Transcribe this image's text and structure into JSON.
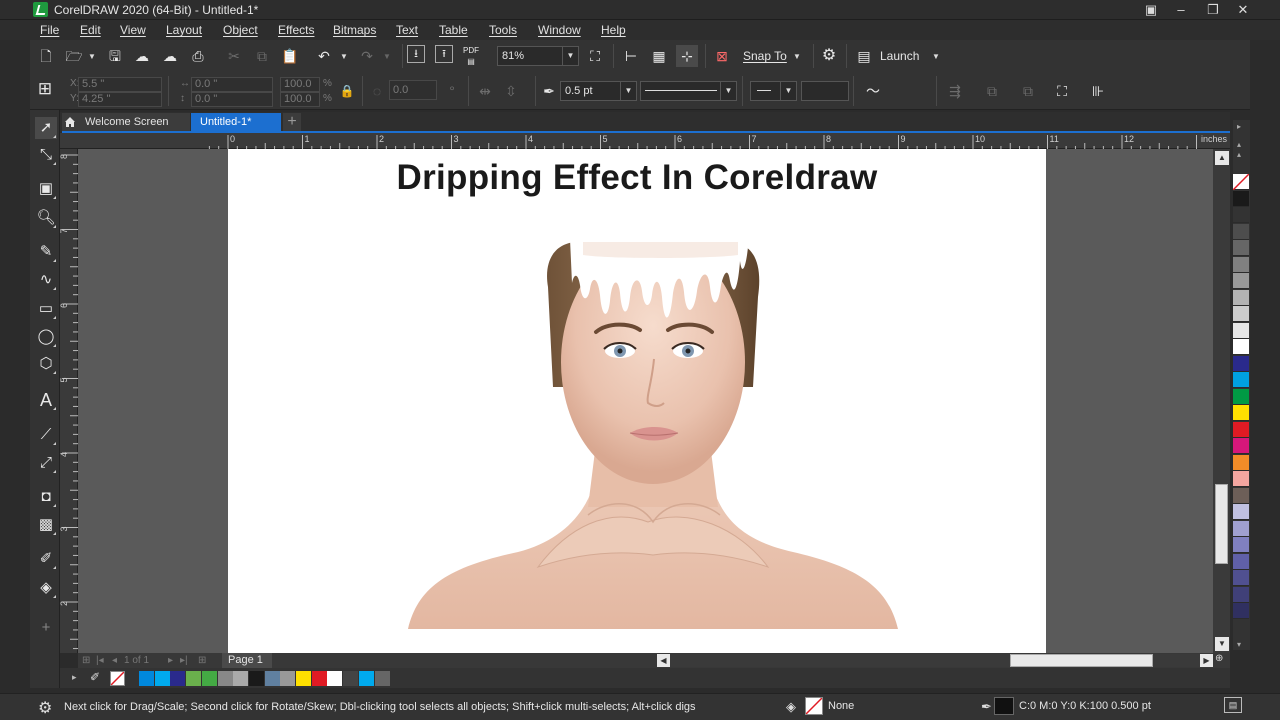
{
  "window": {
    "title": "CorelDRAW 2020 (64-Bit) - Untitled-1*",
    "controls": [
      "□",
      "–",
      "❐",
      "✕"
    ]
  },
  "menu": [
    "File",
    "Edit",
    "View",
    "Layout",
    "Object",
    "Effects",
    "Bitmaps",
    "Text",
    "Table",
    "Tools",
    "Window",
    "Help"
  ],
  "standard_toolbar": {
    "pdf_label": "PDF",
    "zoom": "81%",
    "snap_to": "Snap To",
    "launch": "Launch"
  },
  "property_bar": {
    "x": "5.5 \"",
    "y": "4.25 \"",
    "w": "0.0 \"",
    "h": "0.0 \"",
    "scale_x": "100.0",
    "scale_y": "100.0",
    "pct": "%",
    "rotation": "0.0",
    "outline_width": "0.5 pt"
  },
  "tabs": {
    "welcome": "Welcome Screen",
    "document": "Untitled-1*",
    "add": "+"
  },
  "ruler": {
    "units": "inches",
    "h_labels": [
      "0",
      "1",
      "2",
      "3",
      "4",
      "5",
      "6",
      "7",
      "8",
      "9",
      "10",
      "11",
      "12"
    ],
    "v_labels": [
      "8",
      "7",
      "6",
      "5",
      "4",
      "3",
      "2"
    ]
  },
  "document": {
    "headline": "Dripping Effect In Coreldraw"
  },
  "page_nav": {
    "page_count": "1 of 1",
    "page_tab": "Page 1"
  },
  "status": {
    "hint": "Next click for Drag/Scale; Second click for Rotate/Skew; Dbl-clicking tool selects all objects; Shift+click multi-selects; Alt+click digs",
    "fill": "None",
    "outline": "C:0 M:0 Y:0 K:100  0.500 pt"
  },
  "colors": {
    "accent": "#1c6fd0",
    "palette": [
      "#ffffff00",
      "#1a1a1a",
      "#333333",
      "#4d4d4d",
      "#666666",
      "#808080",
      "#999999",
      "#b3b3b3",
      "#cccccc",
      "#e6e6e6",
      "#ffffff",
      "#2a2a8c",
      "#00a0e0",
      "#009a44",
      "#ffe000",
      "#e01b24",
      "#d6177a",
      "#f28c28",
      "#f4a6a0",
      "#6d5f58",
      "#c0c0e0",
      "#a0a0d0",
      "#8080c0",
      "#6060a8",
      "#505090",
      "#404078",
      "#303060"
    ],
    "doc_palette": [
      "#0088dd",
      "#00aaee",
      "#2a2a8c",
      "#6ab04c",
      "#44aa44",
      "#888888",
      "#aaaaaa",
      "#1a1a1a",
      "#6080a0",
      "#999999",
      "#ffe000",
      "#e01b24",
      "#ffffff",
      "#444444",
      "#00aaee",
      "#666666"
    ]
  }
}
